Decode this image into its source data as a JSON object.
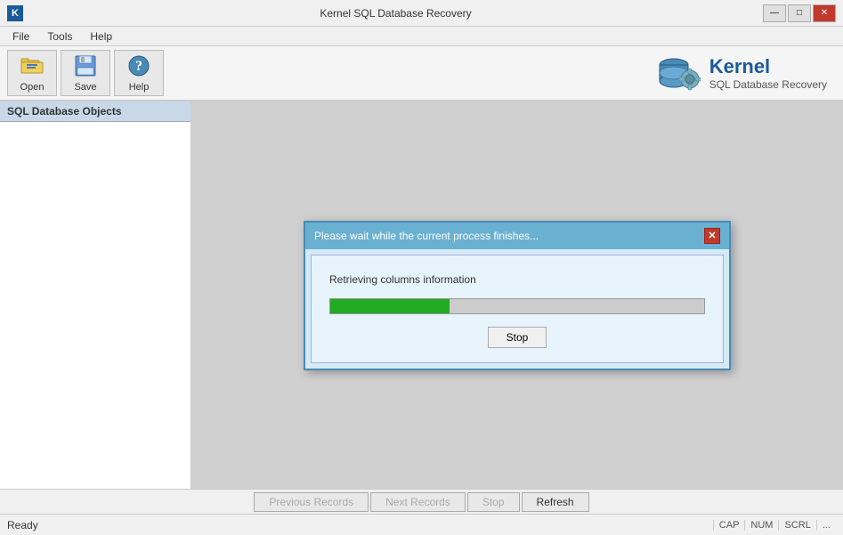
{
  "window": {
    "title": "Kernel SQL Database Recovery",
    "app_icon": "K"
  },
  "title_controls": {
    "minimize": "—",
    "maximize": "□",
    "close": "✕"
  },
  "menu": {
    "items": [
      "File",
      "Tools",
      "Help"
    ]
  },
  "toolbar": {
    "buttons": [
      {
        "id": "open",
        "label": "Open"
      },
      {
        "id": "save",
        "label": "Save"
      },
      {
        "id": "help",
        "label": "Help"
      }
    ],
    "logo_kernel": "Kernel",
    "logo_subtitle": "SQL Database Recovery"
  },
  "left_panel": {
    "header": "SQL Database Objects"
  },
  "modal": {
    "title": "Please wait while the current process finishes...",
    "message": "Retrieving columns information",
    "progress_percent": 32,
    "stop_label": "Stop"
  },
  "bottom_bar": {
    "prev_records": "Previous Records",
    "next_records": "Next Records",
    "stop_label": "Stop",
    "refresh_label": "Refresh"
  },
  "status_bar": {
    "status": "Ready",
    "cap": "CAP",
    "num": "NUM",
    "scrl": "SCRL",
    "dots": "..."
  }
}
